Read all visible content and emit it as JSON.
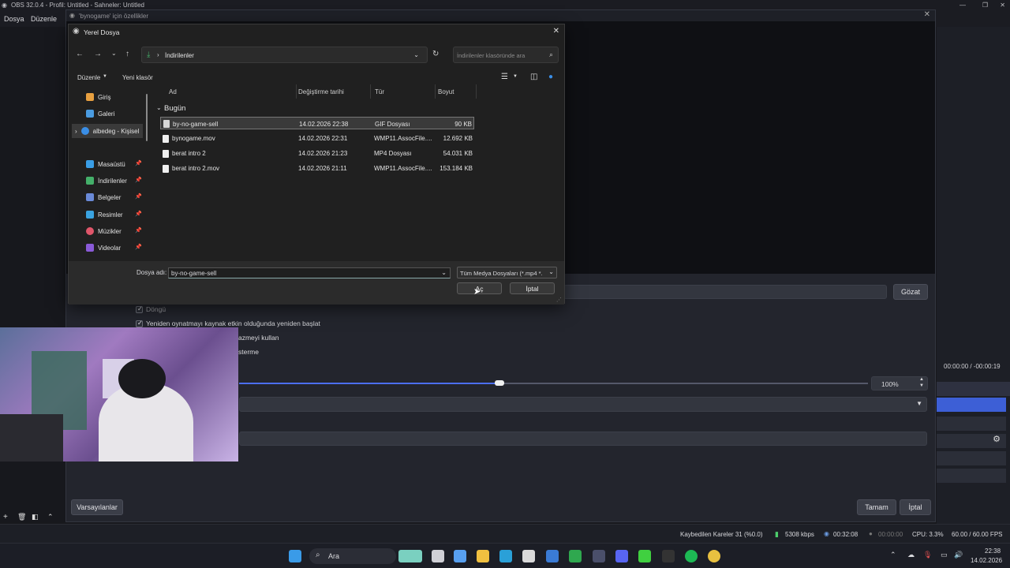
{
  "obs": {
    "title": "OBS 32.0.4 - Profil: Untitled - Sahneler: Untitled",
    "menu": [
      "Dosya",
      "Düzenle"
    ]
  },
  "props_window": {
    "title": "'bynogame' için özellikler",
    "checkbox_loop": "Döngü",
    "checkbox_restart": "Yeniden oynatmayı kaynak etkin olduğunda yeniden başlat",
    "checkbox_partial_1": "azmeyi kullan",
    "checkbox_partial_2": "sterme",
    "browse_button": "Gözat",
    "speed_value": "100%",
    "defaults_button": "Varsayılanlar",
    "ok_button": "Tamam",
    "cancel_button": "İptal",
    "time": "00:00:00 / -00:00:19"
  },
  "dialog": {
    "title": "Yerel Dosya",
    "address": "İndirilenler",
    "search_placeholder": "İndirilenler klasöründe ara",
    "toolbar": {
      "organize": "Düzenle",
      "new_folder": "Yeni klasör"
    },
    "sidebar": [
      {
        "label": "Giriş",
        "color": "#e8a040"
      },
      {
        "label": "Galeri",
        "color": "#4a9be0"
      },
      {
        "label": "albedeg - Kişisel",
        "color": "#3a8ee6"
      },
      {
        "label": "Masaüstü",
        "color": "#3a9ee6"
      },
      {
        "label": "İndirilenler",
        "color": "#44b06a"
      },
      {
        "label": "Belgeler",
        "color": "#6a8ad8"
      },
      {
        "label": "Resimler",
        "color": "#3aa3e0"
      },
      {
        "label": "Müzikler",
        "color": "#e0566a"
      },
      {
        "label": "Videolar",
        "color": "#8a5ad8"
      }
    ],
    "columns": {
      "name": "Ad",
      "modified": "Değiştirme tarihi",
      "type": "Tür",
      "size": "Boyut"
    },
    "group": "Bugün",
    "files": [
      {
        "name": "by-no-game-sell",
        "modified": "14.02.2026 22:38",
        "type": "GIF Dosyası",
        "size": "90 KB"
      },
      {
        "name": "bynogame.mov",
        "modified": "14.02.2026 22:31",
        "type": "WMP11.AssocFile....",
        "size": "12.692 KB"
      },
      {
        "name": "berat intro 2",
        "modified": "14.02.2026 21:23",
        "type": "MP4 Dosyası",
        "size": "54.031 KB"
      },
      {
        "name": "berat intro 2.mov",
        "modified": "14.02.2026 21:11",
        "type": "WMP11.AssocFile....",
        "size": "153.184 KB"
      }
    ],
    "filename_label": "Dosya adı:",
    "filename_value": "by-no-game-sell",
    "filetype_value": "Tüm Medya Dosyaları (*.mp4 *.",
    "open_button": "Aç",
    "cancel_button": "İptal"
  },
  "status_bar": {
    "dropped": "Kaybedilen Kareler 31 (%0.0)",
    "bitrate": "5308 kbps",
    "rec_time": "00:32:08",
    "stream_time": "00:00:00",
    "cpu": "CPU: 3.3%",
    "fps": "60.00 / 60.00 FPS"
  },
  "taskbar": {
    "search": "Ara",
    "time": "22:38",
    "date": "14.02.2026"
  }
}
